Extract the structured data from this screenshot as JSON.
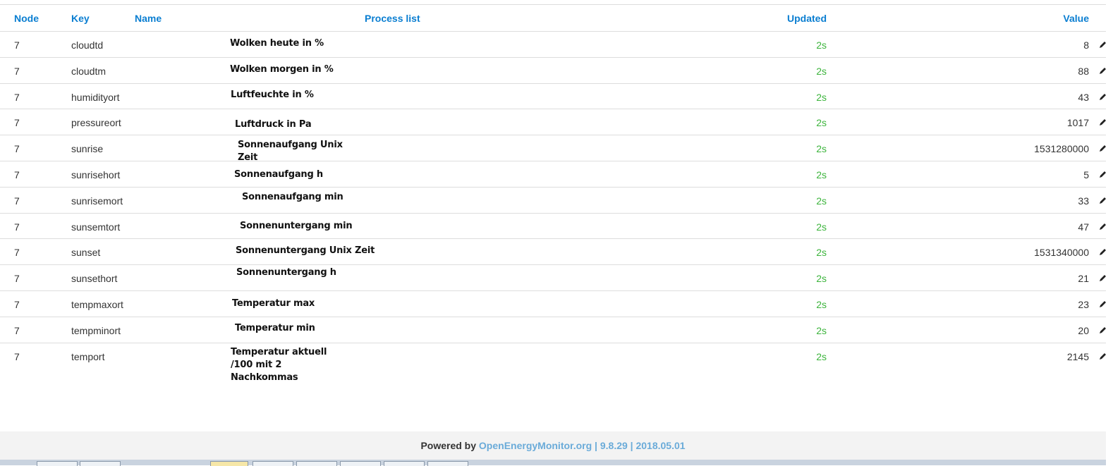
{
  "table": {
    "headers": {
      "node": "Node",
      "key": "Key",
      "name": "Name",
      "process_list": "Process list",
      "updated": "Updated",
      "value": "Value"
    },
    "rows": [
      {
        "node": "7",
        "key": "cloudtd",
        "updated": "2s",
        "value": "8",
        "note": "Wolken heute in %"
      },
      {
        "node": "7",
        "key": "cloudtm",
        "updated": "2s",
        "value": "88",
        "note": "Wolken morgen in %"
      },
      {
        "node": "7",
        "key": "humidityort",
        "updated": "2s",
        "value": "43",
        "note": "Luftfeuchte in %"
      },
      {
        "node": "7",
        "key": "pressureort",
        "updated": "2s",
        "value": "1017",
        "note": "Luftdruck in Pa"
      },
      {
        "node": "7",
        "key": "sunrise",
        "updated": "2s",
        "value": "1531280000",
        "note": "Sonnenaufgang Unix\nZeit"
      },
      {
        "node": "7",
        "key": "sunrisehort",
        "updated": "2s",
        "value": "5",
        "note": "Sonnenaufgang h"
      },
      {
        "node": "7",
        "key": "sunrisemort",
        "updated": "2s",
        "value": "33",
        "note": "Sonnenaufgang min"
      },
      {
        "node": "7",
        "key": "sunsemtort",
        "updated": "2s",
        "value": "47",
        "note": "Sonnenuntergang min"
      },
      {
        "node": "7",
        "key": "sunset",
        "updated": "2s",
        "value": "1531340000",
        "note": "Sonnenuntergang Unix Zeit"
      },
      {
        "node": "7",
        "key": "sunsethort",
        "updated": "2s",
        "value": "21",
        "note": "Sonnenuntergang h"
      },
      {
        "node": "7",
        "key": "tempmaxort",
        "updated": "2s",
        "value": "23",
        "note": "Temperatur max"
      },
      {
        "node": "7",
        "key": "tempminort",
        "updated": "2s",
        "value": "20",
        "note": "Temperatur min"
      },
      {
        "node": "7",
        "key": "temport",
        "updated": "2s",
        "value": "2145",
        "note": "Temperatur aktuell\n/100 mit 2\nNachkommas"
      }
    ],
    "row_action_icon": "pencil-icon"
  },
  "footer": {
    "powered_by": "Powered by",
    "link": "OpenEnergyMonitor.org",
    "version_info": "| 9.8.29 | 2018.05.01"
  },
  "colors": {
    "header_text": "#0a7ed1",
    "updated_text": "#3cb43c",
    "footer_link": "#6aabd9"
  }
}
